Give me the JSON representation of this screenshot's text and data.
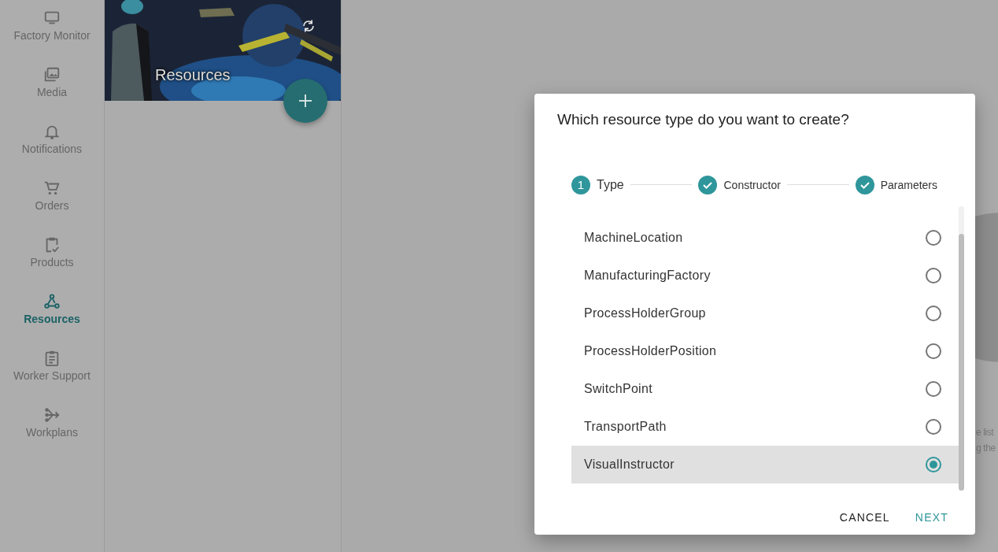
{
  "sidebar": {
    "items": [
      {
        "label": "Factory Monitor",
        "selected": false
      },
      {
        "label": "Media",
        "selected": false
      },
      {
        "label": "Notifications",
        "selected": false
      },
      {
        "label": "Orders",
        "selected": false
      },
      {
        "label": "Products",
        "selected": false
      },
      {
        "label": "Resources",
        "selected": true
      },
      {
        "label": "Worker Support",
        "selected": false
      },
      {
        "label": "Workplans",
        "selected": false
      }
    ]
  },
  "resources_panel": {
    "title": "Resources"
  },
  "background_text": [
    "e list",
    "g the"
  ],
  "dialog": {
    "title": "Which resource type do you want to create?",
    "steps": [
      {
        "number": "1",
        "label": "Type",
        "completed": false
      },
      {
        "label": "Constructor",
        "completed": true
      },
      {
        "label": "Parameters",
        "completed": true
      }
    ],
    "options": [
      {
        "label": "MachineLocation",
        "selected": false
      },
      {
        "label": "ManufacturingFactory",
        "selected": false
      },
      {
        "label": "ProcessHolderGroup",
        "selected": false
      },
      {
        "label": "ProcessHolderPosition",
        "selected": false
      },
      {
        "label": "SwitchPoint",
        "selected": false
      },
      {
        "label": "TransportPath",
        "selected": false
      },
      {
        "label": "VisualInstructor",
        "selected": true
      }
    ],
    "buttons": [
      {
        "label": "CANCEL",
        "kind": "plain"
      },
      {
        "label": "NEXT",
        "kind": "primary"
      }
    ]
  }
}
